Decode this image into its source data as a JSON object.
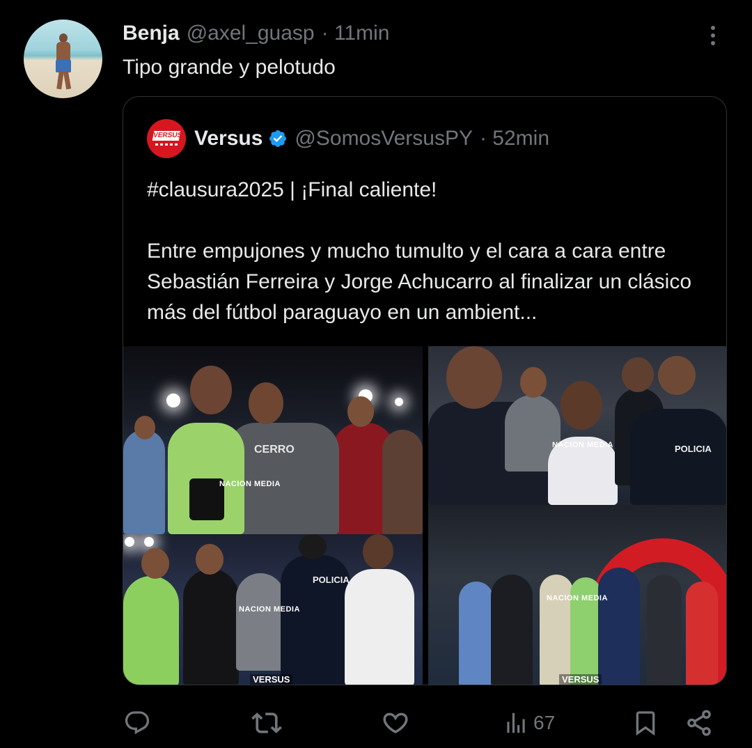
{
  "tweet": {
    "author_name": "Benja",
    "author_handle": "@axel_guasp",
    "time": "· 11min",
    "text": "Tipo grande y pelotudo"
  },
  "quote": {
    "author_name": "Versus",
    "author_handle": "@SomosVersusPY",
    "time": "· 52min",
    "verified": true,
    "line1": "#clausura2025 | ¡Final caliente!",
    "line2": "Entre empujones y mucho tumulto y el cara a cara entre Sebastián Ferreira y Jorge Achucarro al finalizar un clásico más del fútbol paraguayo en un ambient...",
    "photos": [
      {
        "watermark": "NACION MEDIA",
        "shirt_text": "CERRO"
      },
      {
        "watermark": "NACION MEDIA",
        "shirt_text": "POLICIA"
      },
      {
        "watermark": "NACION MEDIA",
        "shirt_text": "POLICIA",
        "bottom_logo": "VERSUS"
      },
      {
        "watermark": "NACION MEDIA",
        "bottom_logo": "VERSUS"
      }
    ],
    "avatar_logo_text": "VERSUS"
  },
  "actions": {
    "reply_icon": "reply-icon",
    "retweet_icon": "retweet-icon",
    "like_icon": "heart-icon",
    "views_icon": "views-icon",
    "views_count": "67",
    "bookmark_icon": "bookmark-icon",
    "share_icon": "share-icon"
  },
  "colors": {
    "background": "#000000",
    "text": "#e7e9ea",
    "muted": "#71767b",
    "verified_blue": "#1d9bf0",
    "border": "#2f3336"
  }
}
